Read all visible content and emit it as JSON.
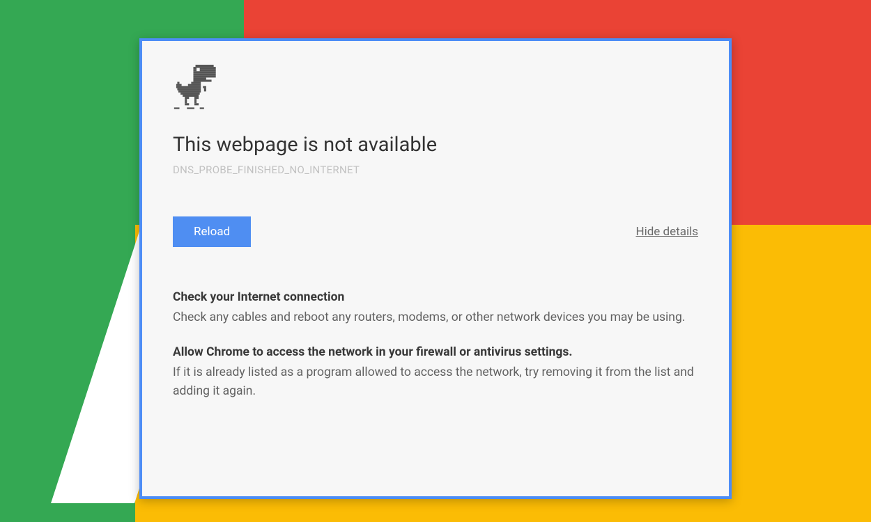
{
  "error": {
    "title": "This webpage is not available",
    "code": "DNS_PROBE_FINISHED_NO_INTERNET",
    "reload_label": "Reload",
    "details_toggle_label": "Hide details",
    "details": [
      {
        "heading": "Check your Internet connection",
        "body": "Check any cables and reboot any routers, modems, or other network devices you may be using."
      },
      {
        "heading": "Allow Chrome to access the network in your firewall or antivirus settings.",
        "body": "If it is already listed as a program allowed to access the network, try removing it from the list and adding it again."
      }
    ]
  },
  "colors": {
    "card_border": "#4d8df6",
    "button_bg": "#4f8ef2",
    "green": "#34a853",
    "red": "#ea4335",
    "yellow": "#fbbc05"
  }
}
